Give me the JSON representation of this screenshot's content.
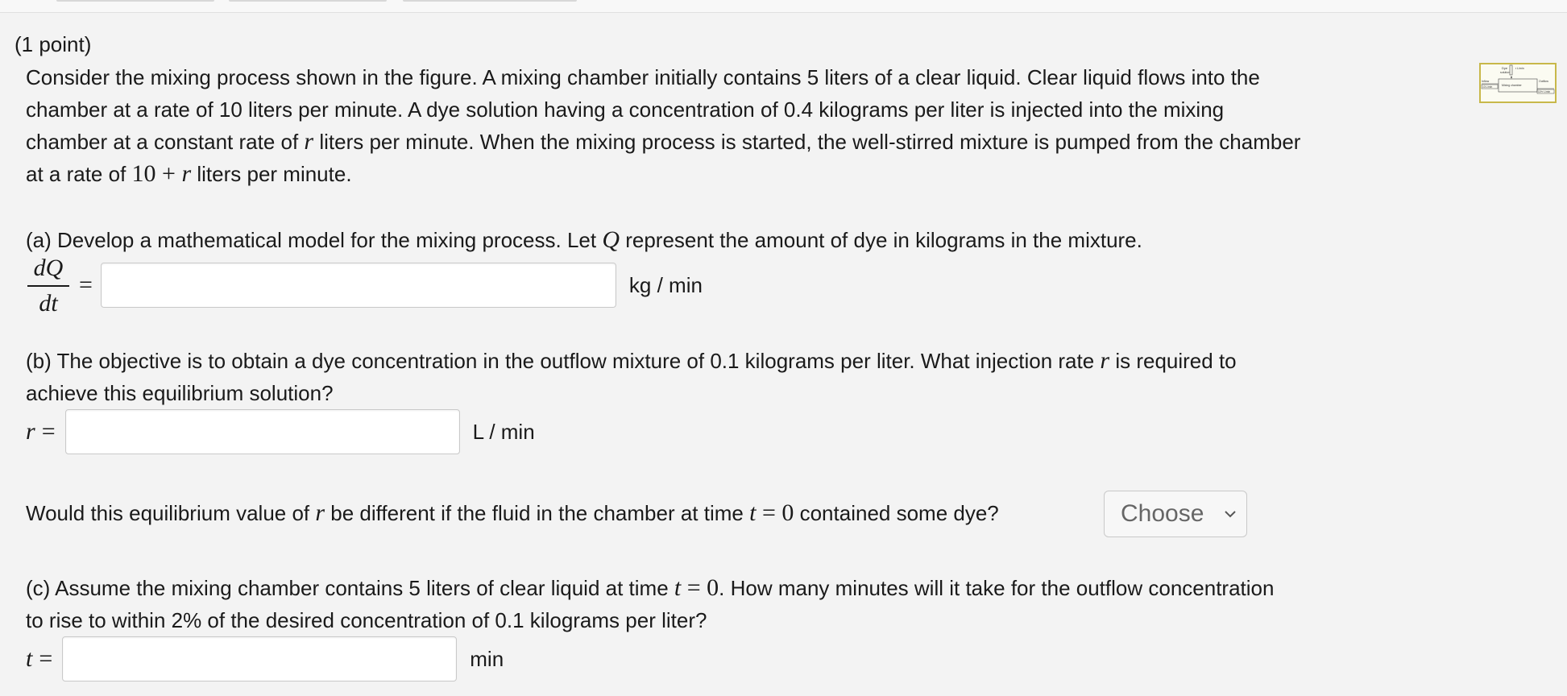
{
  "header": {
    "points": "(1 point)"
  },
  "problem": {
    "line1": "Consider the mixing process shown in the figure. A mixing chamber initially contains 5 liters of a clear liquid. Clear liquid flows into the",
    "line2": "chamber at a rate of 10 liters per minute. A dye solution having a concentration of 0.4 kilograms per liter is injected into the mixing",
    "line3_a": "chamber at a constant rate of ",
    "line3_var": "r",
    "line3_b": " liters per minute. When the mixing process is started, the well-stirred mixture is pumped from the chamber",
    "line4_a": "at a rate of ",
    "line4_expr_num": "10 + ",
    "line4_expr_var": "r",
    "line4_b": " liters per minute.",
    "figure": {
      "dye": "Dye",
      "solution": "solution",
      "rate": "r L/min",
      "inflow": "Inflow",
      "inflow_rate": "10 L/min",
      "chamber": "Mixing chamber",
      "outflow": "Outflow",
      "outflow_rate": "10+r L/min"
    }
  },
  "part_a": {
    "text_a": "(a) Develop a mathematical model for the mixing process. Let ",
    "var": "Q",
    "text_b": " represent the amount of dye in kilograms in the mixture.",
    "frac_num": "dQ",
    "frac_den": "dt",
    "equals": "=",
    "value": "",
    "unit": "kg / min"
  },
  "part_b": {
    "line1_a": "(b) The objective is to obtain a dye concentration in the outflow mixture of 0.1 kilograms per liter. What injection rate ",
    "line1_var": "r",
    "line1_b": " is required to",
    "line2": "achieve this equilibrium solution?",
    "lhs_var": "r",
    "equals": "=",
    "value": "",
    "unit": "L / min"
  },
  "question_eq": {
    "text_a": "Would this equilibrium value of ",
    "var_r": "r",
    "text_b": " be different if the fluid in the chamber at time ",
    "var_t": "t",
    "eq_rhs": " = 0",
    "text_c": " contained some dye?",
    "select_value": "Choose"
  },
  "part_c": {
    "line1_a": "(c) Assume the mixing chamber contains 5 liters of clear liquid at time ",
    "line1_var": "t",
    "line1_eq": " = 0",
    "line1_b": ". How many minutes will it take for the outflow concentration",
    "line2": "to rise to within 2% of the desired concentration of 0.1 kilograms per liter?",
    "lhs_var": "t",
    "equals": "=",
    "value": "",
    "unit": "min"
  }
}
